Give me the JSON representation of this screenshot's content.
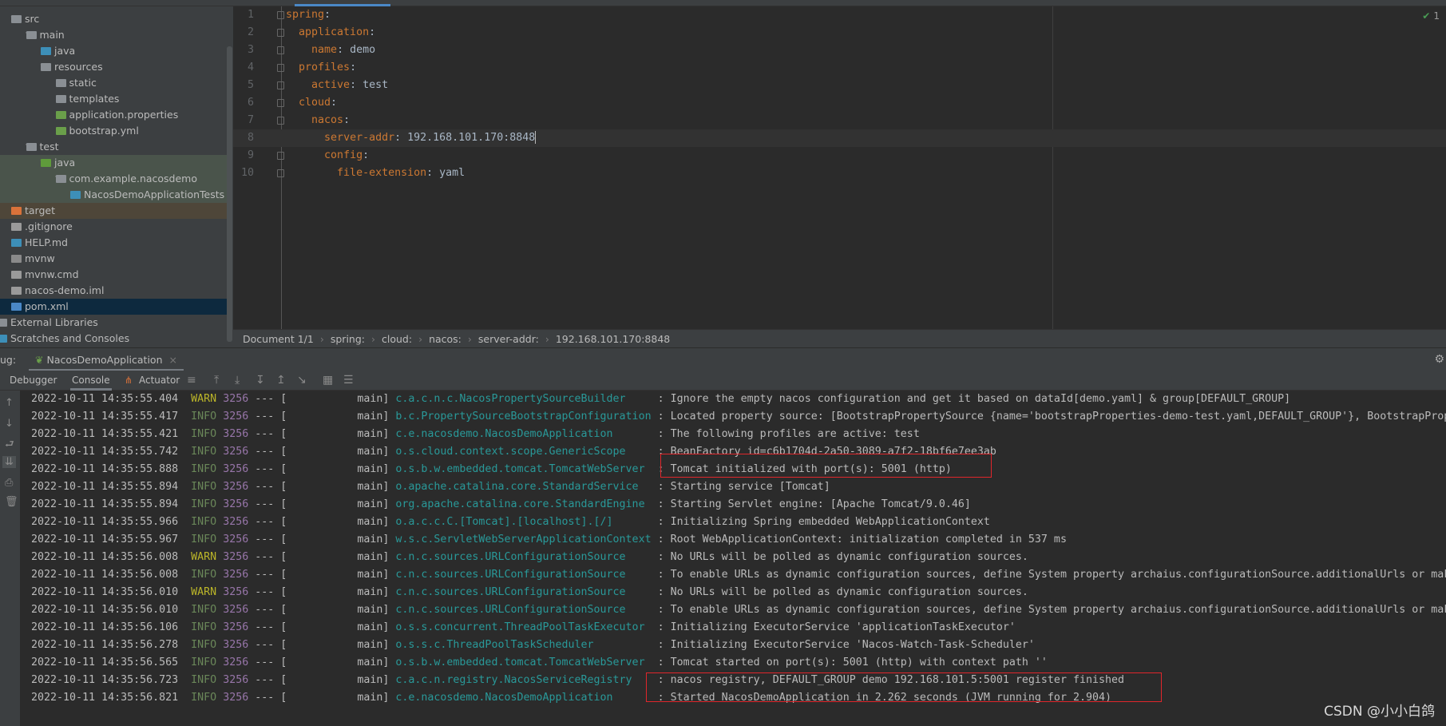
{
  "colors": {
    "accent": "#4a88c7",
    "warn": "#bbb529",
    "info": "#6a8759",
    "pid": "#9876aa",
    "logger": "#299999",
    "highlight_box": "#e0262b"
  },
  "project_tree": [
    {
      "label": "src",
      "depth": 0,
      "chev": "v",
      "icon": "folder",
      "color": "#8a8f94"
    },
    {
      "label": "main",
      "depth": 1,
      "chev": "v",
      "icon": "folder",
      "color": "#8a8f94"
    },
    {
      "label": "java",
      "depth": 2,
      "chev": ">",
      "icon": "source-folder",
      "color": "#3d8fb8"
    },
    {
      "label": "resources",
      "depth": 2,
      "chev": "v",
      "icon": "resources-folder",
      "color": "#8a8f94"
    },
    {
      "label": "static",
      "depth": 3,
      "icon": "folder",
      "color": "#8a8f94"
    },
    {
      "label": "templates",
      "depth": 3,
      "icon": "folder",
      "color": "#8a8f94"
    },
    {
      "label": "application.properties",
      "depth": 3,
      "icon": "spring-properties",
      "color": "#6a9f4a"
    },
    {
      "label": "bootstrap.yml",
      "depth": 3,
      "icon": "spring-yaml",
      "color": "#6a9f4a"
    },
    {
      "label": "test",
      "depth": 1,
      "chev": "v",
      "icon": "folder",
      "color": "#8a8f94"
    },
    {
      "label": "java",
      "depth": 2,
      "chev": "v",
      "icon": "test-folder",
      "color": "#5f9b3b",
      "bg": "#4a544b"
    },
    {
      "label": "com.example.nacosdemo",
      "depth": 3,
      "chev": "v",
      "icon": "package",
      "color": "#8a8f94",
      "bg": "#4a544b",
      "chevdepth": 2
    },
    {
      "label": "NacosDemoApplicationTests",
      "depth": 4,
      "icon": "test-class",
      "color": "#3d8fb8",
      "bg": "#4a544b"
    },
    {
      "label": "target",
      "depth": 0,
      "chev": ">",
      "icon": "excluded-folder",
      "color": "#d9723a",
      "bg": "#4e4639"
    },
    {
      "label": ".gitignore",
      "depth": 0,
      "icon": "gitignore-file",
      "color": "#9a9a9a"
    },
    {
      "label": "HELP.md",
      "depth": 0,
      "icon": "markdown-file",
      "color": "#3d8fb8"
    },
    {
      "label": "mvnw",
      "depth": 0,
      "icon": "shell-file",
      "color": "#8a8a8a"
    },
    {
      "label": "mvnw.cmd",
      "depth": 0,
      "icon": "text-file",
      "color": "#9a9a9a"
    },
    {
      "label": "nacos-demo.iml",
      "depth": 0,
      "icon": "module-file",
      "color": "#9a9a9a"
    },
    {
      "label": "pom.xml",
      "depth": 0,
      "icon": "maven-file",
      "color": "#4a88c7",
      "bg": "#0d293e",
      "selected": true
    },
    {
      "label": "External Libraries",
      "depth": -1,
      "icon": "library",
      "color": "#8a8f94"
    },
    {
      "label": "Scratches and Consoles",
      "depth": -1,
      "icon": "scratches",
      "color": "#3d8fb8"
    }
  ],
  "editor": {
    "lines": [
      {
        "n": "1",
        "indent": "",
        "key": "spring",
        "val": ""
      },
      {
        "n": "2",
        "indent": "  ",
        "key": "application",
        "val": ""
      },
      {
        "n": "3",
        "indent": "    ",
        "key": "name",
        "val": "demo"
      },
      {
        "n": "4",
        "indent": "  ",
        "key": "profiles",
        "val": ""
      },
      {
        "n": "5",
        "indent": "    ",
        "key": "active",
        "val": "test"
      },
      {
        "n": "6",
        "indent": "  ",
        "key": "cloud",
        "val": ""
      },
      {
        "n": "7",
        "indent": "    ",
        "key": "nacos",
        "val": ""
      },
      {
        "n": "8",
        "indent": "      ",
        "key": "server-addr",
        "val": "192.168.101.170:8848",
        "current": true
      },
      {
        "n": "9",
        "indent": "      ",
        "key": "config",
        "val": ""
      },
      {
        "n": "10",
        "indent": "        ",
        "key": "file-extension",
        "val": "yaml"
      }
    ],
    "inspection_count": "1"
  },
  "breadcrumb": [
    "Document 1/1",
    "spring:",
    "cloud:",
    "nacos:",
    "server-addr:",
    "192.168.101.170:8848"
  ],
  "run": {
    "prefix": "ug:",
    "tab_label": "NacosDemoApplication",
    "close": "×"
  },
  "toolbar": {
    "debugger": "Debugger",
    "console": "Console",
    "actuator": "Actuator"
  },
  "log": [
    {
      "ts": "2022-10-11 14:35:55.404",
      "level": "WARN",
      "pid": "3256",
      "thread": "main",
      "logger": "c.a.c.n.c.NacosPropertySourceBuilder",
      "msg": "Ignore the empty nacos configuration and get it based on dataId[demo.yaml] & group[DEFAULT_GROUP]"
    },
    {
      "ts": "2022-10-11 14:35:55.417",
      "level": "INFO",
      "pid": "3256",
      "thread": "main",
      "logger": "b.c.PropertySourceBootstrapConfiguration",
      "msg": "Located property source: [BootstrapPropertySource {name='bootstrapProperties-demo-test.yaml,DEFAULT_GROUP'}, BootstrapPropertySource"
    },
    {
      "ts": "2022-10-11 14:35:55.421",
      "level": "INFO",
      "pid": "3256",
      "thread": "main",
      "logger": "c.e.nacosdemo.NacosDemoApplication",
      "msg": "The following profiles are active: test"
    },
    {
      "ts": "2022-10-11 14:35:55.742",
      "level": "INFO",
      "pid": "3256",
      "thread": "main",
      "logger": "o.s.cloud.context.scope.GenericScope",
      "msg": "BeanFactory id=c6b1704d-2a50-3089-a7f2-18bf6e7ee3ab"
    },
    {
      "ts": "2022-10-11 14:35:55.888",
      "level": "INFO",
      "pid": "3256",
      "thread": "main",
      "logger": "o.s.b.w.embedded.tomcat.TomcatWebServer",
      "msg": "Tomcat initialized with port(s): 5001 (http)"
    },
    {
      "ts": "2022-10-11 14:35:55.894",
      "level": "INFO",
      "pid": "3256",
      "thread": "main",
      "logger": "o.apache.catalina.core.StandardService",
      "msg": "Starting service [Tomcat]"
    },
    {
      "ts": "2022-10-11 14:35:55.894",
      "level": "INFO",
      "pid": "3256",
      "thread": "main",
      "logger": "org.apache.catalina.core.StandardEngine",
      "msg": "Starting Servlet engine: [Apache Tomcat/9.0.46]"
    },
    {
      "ts": "2022-10-11 14:35:55.966",
      "level": "INFO",
      "pid": "3256",
      "thread": "main",
      "logger": "o.a.c.c.C.[Tomcat].[localhost].[/]",
      "msg": "Initializing Spring embedded WebApplicationContext"
    },
    {
      "ts": "2022-10-11 14:35:55.967",
      "level": "INFO",
      "pid": "3256",
      "thread": "main",
      "logger": "w.s.c.ServletWebServerApplicationContext",
      "msg": "Root WebApplicationContext: initialization completed in 537 ms"
    },
    {
      "ts": "2022-10-11 14:35:56.008",
      "level": "WARN",
      "pid": "3256",
      "thread": "main",
      "logger": "c.n.c.sources.URLConfigurationSource",
      "msg": "No URLs will be polled as dynamic configuration sources."
    },
    {
      "ts": "2022-10-11 14:35:56.008",
      "level": "INFO",
      "pid": "3256",
      "thread": "main",
      "logger": "c.n.c.sources.URLConfigurationSource",
      "msg": "To enable URLs as dynamic configuration sources, define System property archaius.configurationSource.additionalUrls or mak"
    },
    {
      "ts": "2022-10-11 14:35:56.010",
      "level": "WARN",
      "pid": "3256",
      "thread": "main",
      "logger": "c.n.c.sources.URLConfigurationSource",
      "msg": "No URLs will be polled as dynamic configuration sources."
    },
    {
      "ts": "2022-10-11 14:35:56.010",
      "level": "INFO",
      "pid": "3256",
      "thread": "main",
      "logger": "c.n.c.sources.URLConfigurationSource",
      "msg": "To enable URLs as dynamic configuration sources, define System property archaius.configurationSource.additionalUrls or mak"
    },
    {
      "ts": "2022-10-11 14:35:56.106",
      "level": "INFO",
      "pid": "3256",
      "thread": "main",
      "logger": "o.s.s.concurrent.ThreadPoolTaskExecutor",
      "msg": "Initializing ExecutorService 'applicationTaskExecutor'"
    },
    {
      "ts": "2022-10-11 14:35:56.278",
      "level": "INFO",
      "pid": "3256",
      "thread": "main",
      "logger": "o.s.s.c.ThreadPoolTaskScheduler",
      "msg": "Initializing ExecutorService 'Nacos-Watch-Task-Scheduler'"
    },
    {
      "ts": "2022-10-11 14:35:56.565",
      "level": "INFO",
      "pid": "3256",
      "thread": "main",
      "logger": "o.s.b.w.embedded.tomcat.TomcatWebServer",
      "msg": "Tomcat started on port(s): 5001 (http) with context path ''"
    },
    {
      "ts": "2022-10-11 14:35:56.723",
      "level": "INFO",
      "pid": "3256",
      "thread": "main",
      "logger": "c.a.c.n.registry.NacosServiceRegistry",
      "msg": "nacos registry, DEFAULT_GROUP demo 192.168.101.5:5001 register finished"
    },
    {
      "ts": "2022-10-11 14:35:56.821",
      "level": "INFO",
      "pid": "3256",
      "thread": "main",
      "logger": "c.e.nacosdemo.NacosDemoApplication",
      "msg": "Started NacosDemoApplication in 2.262 seconds (JVM running for 2.904)"
    }
  ],
  "watermark": "CSDN @小小白鸽"
}
